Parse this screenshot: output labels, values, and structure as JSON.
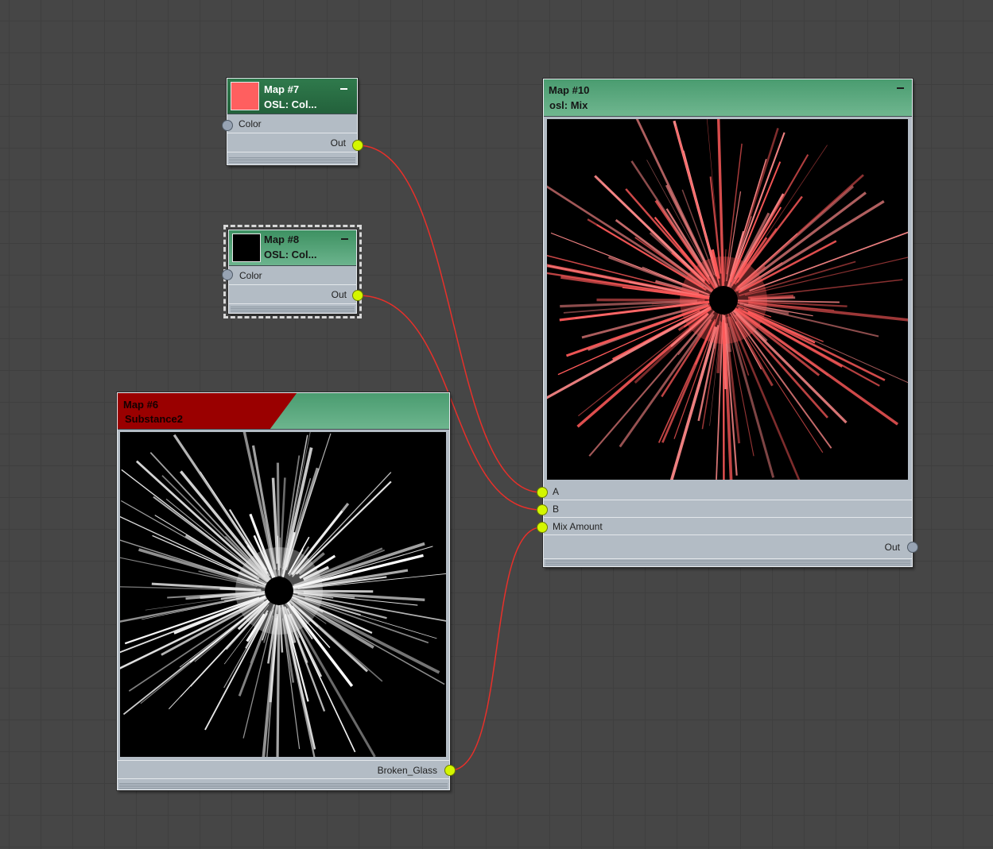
{
  "nodes": {
    "map7": {
      "title": "Map #7",
      "subtitle": "OSL: Col...",
      "swatch_color": "#ff5f5f",
      "input_label": "Color",
      "output_label": "Out"
    },
    "map8": {
      "title": "Map #8",
      "subtitle": "OSL: Col...",
      "swatch_color": "#000000",
      "input_label": "Color",
      "output_label": "Out"
    },
    "map6": {
      "title": "Map #6",
      "subtitle": "Substance2",
      "output_label": "Broken_Glass"
    },
    "map10": {
      "title": "Map #10",
      "subtitle": "osl: Mix",
      "inputs": [
        "A",
        "B",
        "Mix Amount"
      ],
      "output_label": "Out"
    }
  },
  "colors": {
    "wire": "#e8302a",
    "socket_connected": "#d4f600",
    "socket_empty": "#97a3b3",
    "header_green": "#2f7a4c",
    "header_error_red": "#9a0000"
  }
}
